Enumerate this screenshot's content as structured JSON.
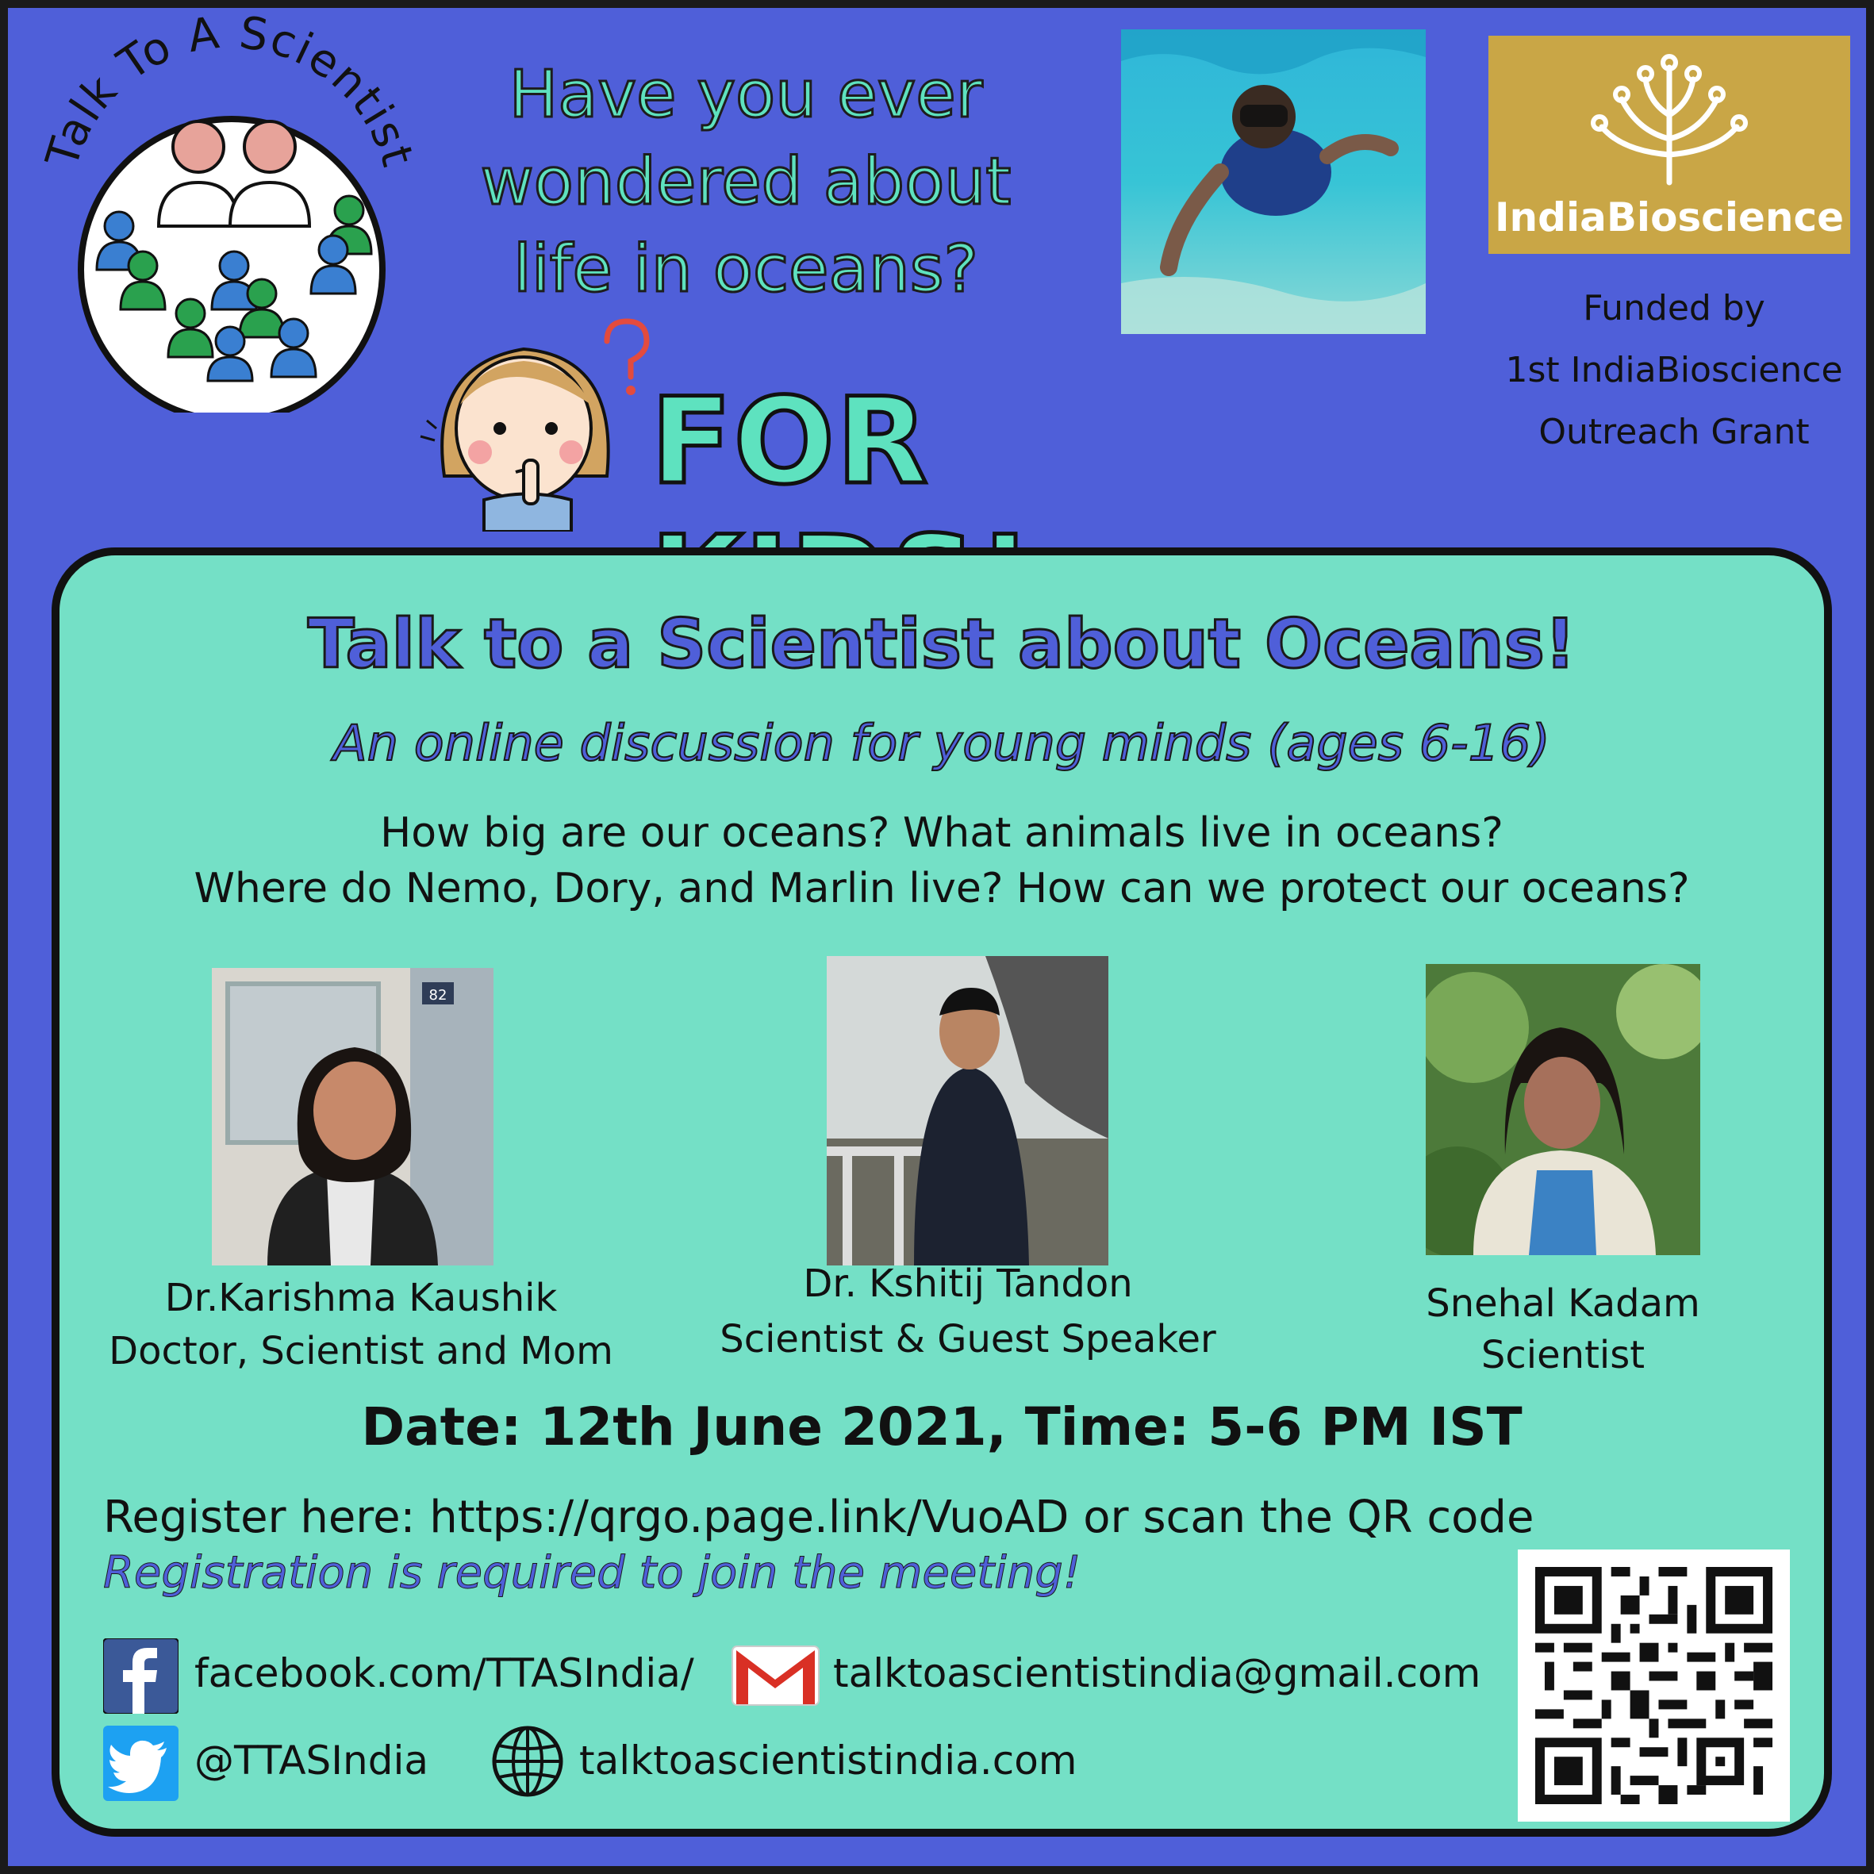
{
  "header": {
    "logo_ring_text": "Talk To A Scientist",
    "question_lines": [
      "Have you ever",
      "wondered about",
      "life in oceans?"
    ],
    "for_kids": "FOR KIDS!",
    "sponsor_logo_text": "IndiaBioscience",
    "funded_lines": [
      "Funded by",
      "1st IndiaBioscience",
      "Outreach Grant"
    ]
  },
  "event": {
    "title": "Talk to a Scientist about Oceans!",
    "subtitle": "An online discussion for young minds (ages 6-16)",
    "questions": [
      "How big are our oceans? What animals live in oceans?",
      "Where do Nemo, Dory, and Marlin live? How can we protect our oceans?"
    ],
    "date_time": "Date: 12th June 2021, Time: 5-6 PM IST",
    "register_text": "Register here: https://qrgo.page.link/VuoAD or scan the QR code",
    "registration_required": "Registration is required to join the meeting!"
  },
  "speakers": [
    {
      "name": "Dr.Karishma Kaushik",
      "role": "Doctor, Scientist and Mom"
    },
    {
      "name": "Dr. Kshitij Tandon",
      "role": "Scientist & Guest Speaker"
    },
    {
      "name": "Snehal Kadam",
      "role": "Scientist"
    }
  ],
  "photo_text": {
    "lab_sign": "82"
  },
  "contacts": {
    "facebook": "facebook.com/TTASIndia/",
    "email": "talktoascientistindia@gmail.com",
    "twitter": "@TTASIndia",
    "website": "talktoascientistindia.com"
  },
  "colors": {
    "background": "#4f5fd9",
    "panel": "#74e0c6",
    "accent_text": "#5ee2bf",
    "sponsor_gold": "#c9a646",
    "facebook": "#3b5998",
    "twitter": "#1da1f2",
    "gmail_red": "#d93025"
  },
  "icons": [
    "facebook-icon",
    "gmail-icon",
    "twitter-icon",
    "globe-icon",
    "qr-code-icon",
    "question-mark-icon"
  ]
}
